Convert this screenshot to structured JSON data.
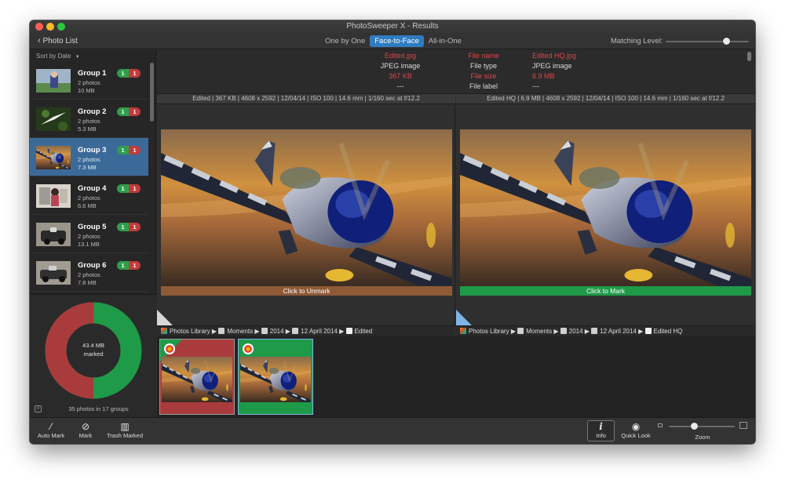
{
  "window": {
    "title": "PhotoSweeper X - Results"
  },
  "toolbar": {
    "back_label": "Photo List",
    "modes": [
      {
        "label": "One by One",
        "active": false
      },
      {
        "label": "Face-to-Face",
        "active": true
      },
      {
        "label": "All-in-One",
        "active": false
      }
    ],
    "matching_label": "Matching Level:"
  },
  "sidebar": {
    "sort_label": "Sort by Date",
    "groups": [
      {
        "name": "Group 1",
        "photos": "2 photos",
        "size": "10 MB",
        "green": "1",
        "red": "1",
        "selected": false
      },
      {
        "name": "Group 2",
        "photos": "2 photos",
        "size": "5.3 MB",
        "green": "1",
        "red": "1",
        "selected": false
      },
      {
        "name": "Group 3",
        "photos": "2 photos",
        "size": "7.3 MB",
        "green": "1",
        "red": "1",
        "selected": true
      },
      {
        "name": "Group 4",
        "photos": "2 photos",
        "size": "6.6 MB",
        "green": "1",
        "red": "1",
        "selected": false
      },
      {
        "name": "Group 5",
        "photos": "2 photos",
        "size": "13.1 MB",
        "green": "1",
        "red": "1",
        "selected": false
      },
      {
        "name": "Group 6",
        "photos": "2 photos",
        "size": "7.8 MB",
        "green": "1",
        "red": "1",
        "selected": false
      }
    ],
    "donut": {
      "marked_line1": "43.4 MB",
      "marked_line2": "marked",
      "marked_fraction": 0.5
    },
    "footer": "35 photos in 17 groups"
  },
  "info": {
    "left": {
      "name": "Edited.jpg",
      "type": "JPEG image",
      "size": "367 KB",
      "label": "---"
    },
    "keys": {
      "name": "File name",
      "type": "File type",
      "size": "File size",
      "label": "File label"
    },
    "right": {
      "name": "Edited HQ.jpg",
      "type": "JPEG image",
      "size": "6.9 MB",
      "label": "---"
    }
  },
  "panes": {
    "left": {
      "meta": "Edited | 367 KB | 4608 x 2592 | 12/04/14 | ISO 100 | 14.6 mm | 1/160 sec at f/12.2",
      "mark_label": "Click to Unmark",
      "path": [
        "Photos Library",
        "Moments",
        "2014",
        "12 April 2014",
        "Edited"
      ]
    },
    "right": {
      "meta": "Edited HQ | 6.9 MB | 4608 x 2592 | 12/04/14 | ISO 100 | 14.6 mm | 1/160 sec at f/12.2",
      "mark_label": "Click to Mark",
      "path": [
        "Photos Library",
        "Moments",
        "2014",
        "12 April 2014",
        "Edited HQ"
      ]
    }
  },
  "path_separator": "▶",
  "bottom": {
    "auto_mark": "Auto Mark",
    "mark": "Mark",
    "trash_marked": "Trash Marked",
    "info": "Info",
    "quick_look": "Quick Look",
    "zoom": "Zoom"
  },
  "colors": {
    "accent": "#2f7cc1",
    "marked": "#c03b3b",
    "keep": "#1f9a48"
  },
  "icons": {
    "back": "chevron-left-icon",
    "info": "info-icon",
    "quick_look": "eye-icon",
    "trash": "trash-icon",
    "mark": "mark-icon",
    "auto_mark": "magic-wand-icon"
  }
}
